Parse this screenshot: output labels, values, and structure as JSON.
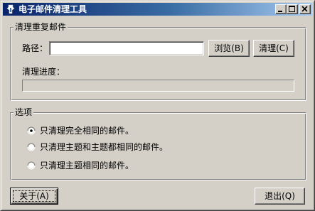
{
  "window": {
    "title": "电子邮件清理工具"
  },
  "groups": {
    "clean": {
      "label": "清理重复邮件",
      "path_label": "路径：",
      "path_value": "",
      "browse_button": "浏览(B)",
      "clean_button": "清理(C)",
      "progress_label": "清理进度：",
      "progress_fraction": 0
    },
    "options": {
      "label": "选项",
      "radios": [
        {
          "label": "只清理完全相同的邮件。",
          "checked": true
        },
        {
          "label": "只清理主题和主题都相同的邮件。",
          "checked": false
        },
        {
          "label": "只清理主题相同的邮件。",
          "checked": false
        }
      ]
    }
  },
  "footer": {
    "about_button": "关于(A)",
    "exit_button": "退出(Q)"
  },
  "colors": {
    "titlebar_start": "#0a246a",
    "titlebar_end": "#a6caf0",
    "face": "#d4d0c8"
  },
  "icons": {
    "app": "app-icon",
    "minimize": "minimize-icon",
    "maximize": "maximize-icon",
    "close": "close-icon"
  }
}
